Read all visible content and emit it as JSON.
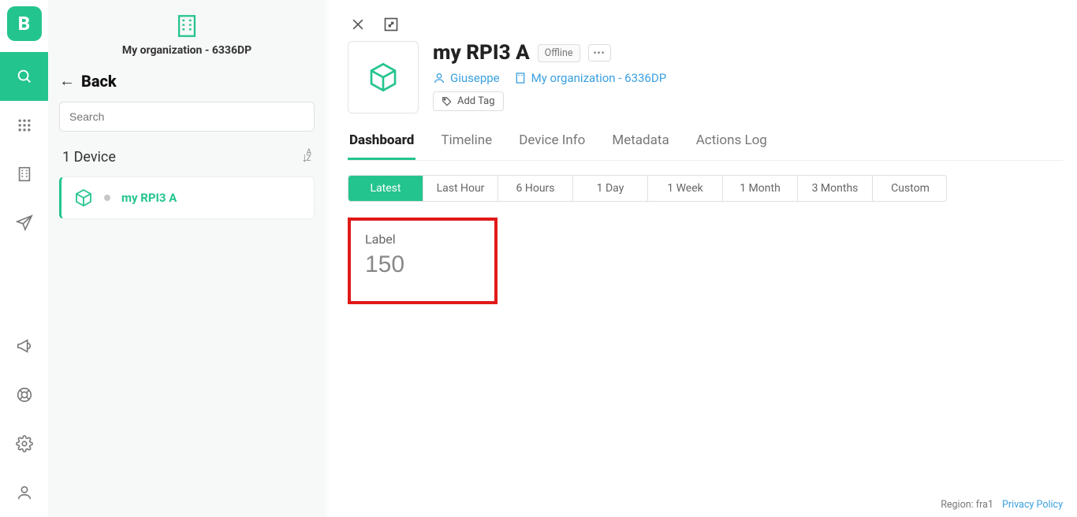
{
  "brand_letter": "B",
  "org_name": "My organization - 6336DP",
  "back_label": "Back",
  "search_placeholder": "Search",
  "device_count_label": "1 Device",
  "devices": [
    {
      "name": "my RPI3 A",
      "status": "offline"
    }
  ],
  "device_detail": {
    "title": "my RPI3 A",
    "status_badge": "Offline",
    "owner": "Giuseppe",
    "org": "My organization - 6336DP",
    "add_tag_label": "Add Tag"
  },
  "tabs": {
    "dashboard": "Dashboard",
    "timeline": "Timeline",
    "device_info": "Device Info",
    "metadata": "Metadata",
    "actions_log": "Actions Log"
  },
  "ranges": {
    "latest": "Latest",
    "last_hour": "Last Hour",
    "six_hours": "6 Hours",
    "one_day": "1 Day",
    "one_week": "1 Week",
    "one_month": "1 Month",
    "three_months": "3 Months",
    "custom": "Custom"
  },
  "widget": {
    "label": "Label",
    "value": "150"
  },
  "footer": {
    "region_label": "Region:",
    "region_value": "fra1",
    "privacy": "Privacy Policy"
  }
}
